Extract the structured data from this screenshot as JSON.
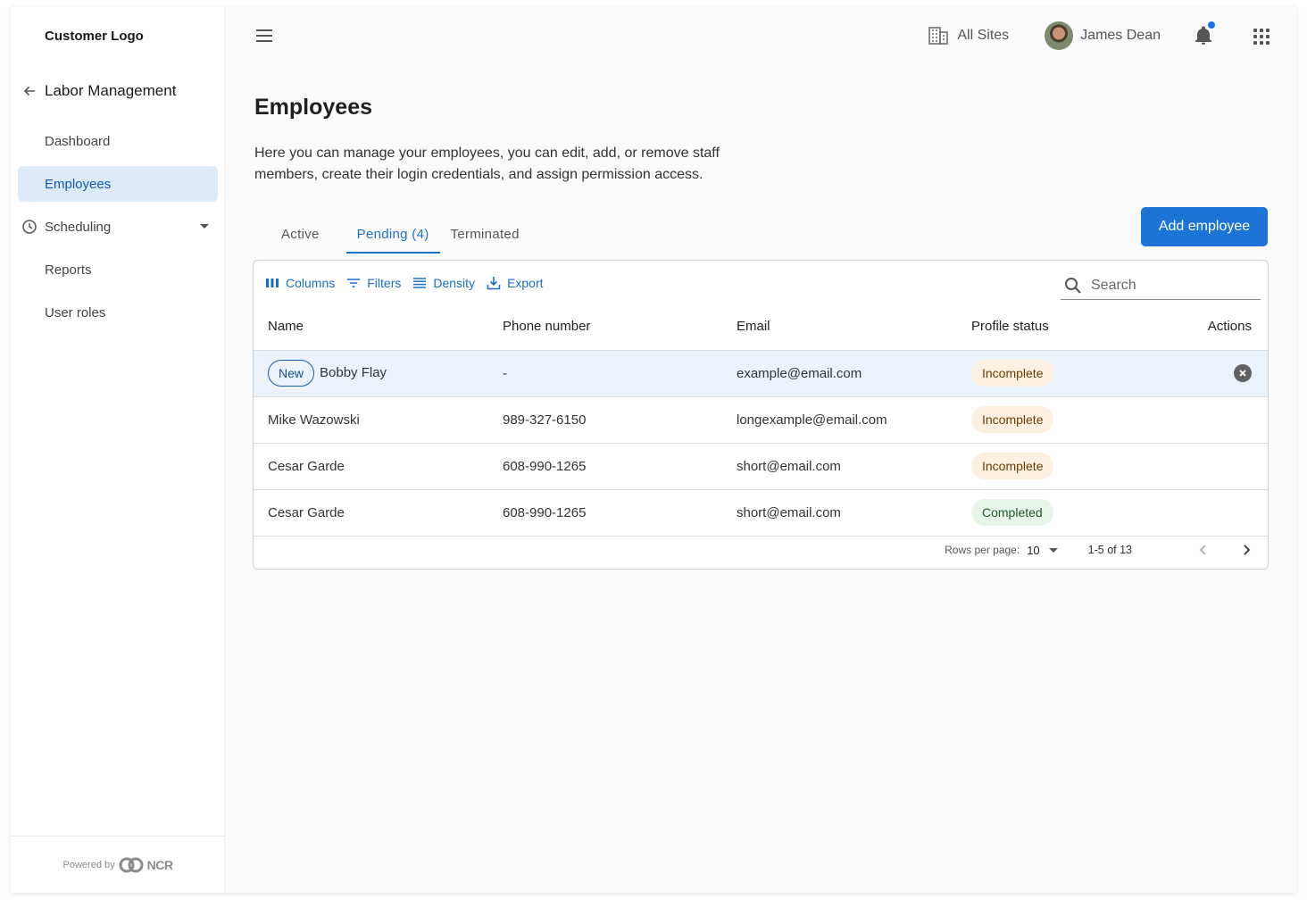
{
  "sidebar": {
    "logo": "Customer Logo",
    "section_title": "Labor Management",
    "items": [
      {
        "label": "Dashboard"
      },
      {
        "label": "Employees"
      },
      {
        "label": "Scheduling"
      },
      {
        "label": "Reports"
      },
      {
        "label": "User roles"
      }
    ],
    "footer_powered": "Powered by",
    "footer_brand": "NCR"
  },
  "header": {
    "sites_label": "All Sites",
    "user_name": "James Dean"
  },
  "page": {
    "title": "Employees",
    "description": "Here you can manage your employees, you can edit, add, or remove staff members, create their login credentials, and assign permission access.",
    "add_button": "Add employee"
  },
  "tabs": [
    {
      "label": "Active"
    },
    {
      "label": "Pending (4)"
    },
    {
      "label": "Terminated"
    }
  ],
  "toolbar": {
    "columns": "Columns",
    "filters": "Filters",
    "density": "Density",
    "export": "Export",
    "search_placeholder": "Search"
  },
  "table": {
    "headers": [
      "Name",
      "Phone number",
      "Email",
      "Profile status",
      "Actions"
    ],
    "rows": [
      {
        "chip": "New",
        "name": "Bobby Flay",
        "phone": "-",
        "email": "example@email.com",
        "status": "Incomplete"
      },
      {
        "name": "Mike Wazowski",
        "phone": "989-327-6150",
        "email": "longexample@email.com",
        "status": "Incomplete"
      },
      {
        "name": "Cesar Garde",
        "phone": "608-990-1265",
        "email": "short@email.com",
        "status": "Incomplete"
      },
      {
        "name": "Cesar Garde",
        "phone": "608-990-1265",
        "email": "short@email.com",
        "status": "Completed"
      }
    ]
  },
  "pagination": {
    "rows_per_page_label": "Rows per page:",
    "rows_per_page_value": "10",
    "range": "1-5 of 13"
  },
  "colors": {
    "accent": "#1b74d6",
    "active_nav_bg": "#dde9f7",
    "incomplete_bg": "#fdf0e1",
    "completed_bg": "#e7f4e8"
  }
}
